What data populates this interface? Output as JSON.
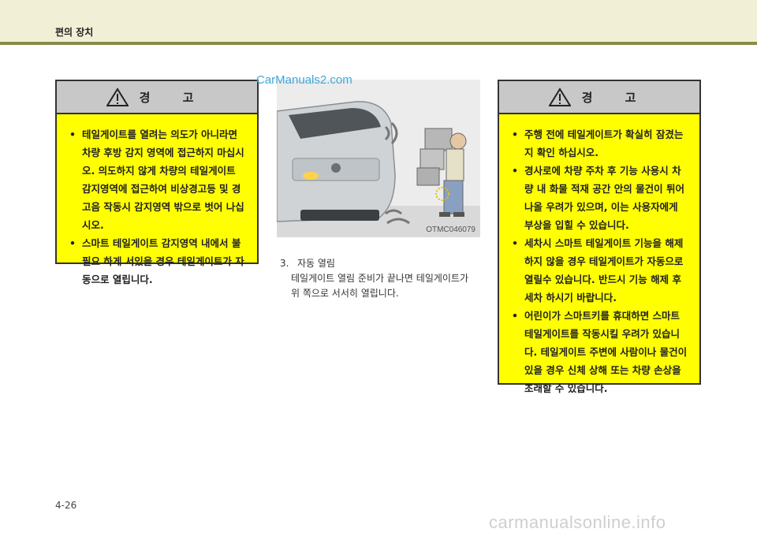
{
  "header": {
    "title": "편의 장치"
  },
  "watermark_top": "CarManuals2.com",
  "warning_left": {
    "title": "경  고",
    "items": [
      "테일게이트를 열려는 의도가 아니라면 차량 후방 감지 영역에 접근하지 마십시오. 의도하지 않게 차량의 테일게이트 감지영역에 접근하여 비상경고등 및 경고음 작동시 감지영역 밖으로 벗어 나십시오.",
      "스마트 테일게이트 감지영역 내에서 불필요 하게 서있을 경우 테일게이트가 자동으로 열립니다."
    ]
  },
  "figure": {
    "code": "OTMC046079"
  },
  "step": {
    "number": "3.",
    "title": "자동 열림",
    "desc_line1": "테일게이트 열림 준비가 끝나면 테일게이트가",
    "desc_line2": "위 쪽으로 서서히 열립니다."
  },
  "warning_right": {
    "title": "경  고",
    "items": [
      "주행 전에 테일게이트가 확실히 잠겼는지 확인 하십시오.",
      "경사로에 차량 주차 후 기능 사용시 차량 내 화물 적재 공간 안의 물건이 튀어나올 우려가 있으며, 이는 사용자에게 부상을 입힐 수 있습니다.",
      "세차시 스마트 테일게이트 기능을 해제 하지 않을 경우 테일게이트가 자동으로 열릴수 있습니다. 반드시 기능 해제 후 세차 하시기 바랍니다.",
      "어린이가 스마트키를 휴대하면 스마트 테일게이트를 작동시킬 우려가 있습니다. 테일게이트 주변에 사람이나 물건이 있을 경우 신체 상해 또는 차량 손상을 초래할 수 있습니다."
    ]
  },
  "page_number": "4-26",
  "footer_watermark": "carmanualsonline.info",
  "colors": {
    "warning_bg": "#ffff00",
    "header_bar": "#8b8a4e",
    "header_band": "#f1f0d6"
  }
}
